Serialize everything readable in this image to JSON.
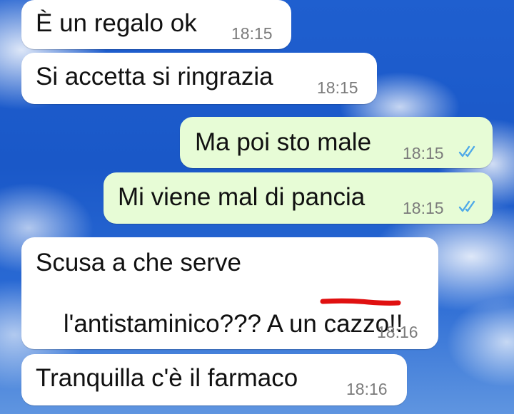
{
  "chat": {
    "messages": [
      {
        "direction": "incoming",
        "text": "È un regalo ok",
        "time": "18:15"
      },
      {
        "direction": "incoming",
        "text": "Si accetta si ringrazia",
        "time": "18:15"
      },
      {
        "direction": "outgoing",
        "text": "Ma poi sto male",
        "time": "18:15",
        "status": "read"
      },
      {
        "direction": "outgoing",
        "text": "Mi viene mal di pancia",
        "time": "18:15",
        "status": "read"
      },
      {
        "direction": "incoming",
        "text_line1": "Scusa a che serve",
        "text_line2_a": "l'antistaminico??? A un ",
        "text_line2_censored": "cazzo",
        "text_line2_b": "!!",
        "time": "18:16"
      },
      {
        "direction": "incoming",
        "text": "Tranquilla c'è il farmaco",
        "time": "18:16"
      }
    ],
    "colors": {
      "incoming_bubble": "#ffffff",
      "outgoing_bubble": "#e7fcd6",
      "read_ticks": "#4fa9e8",
      "censor_mark": "#e01010"
    },
    "icons": [
      "double-check-icon"
    ]
  }
}
